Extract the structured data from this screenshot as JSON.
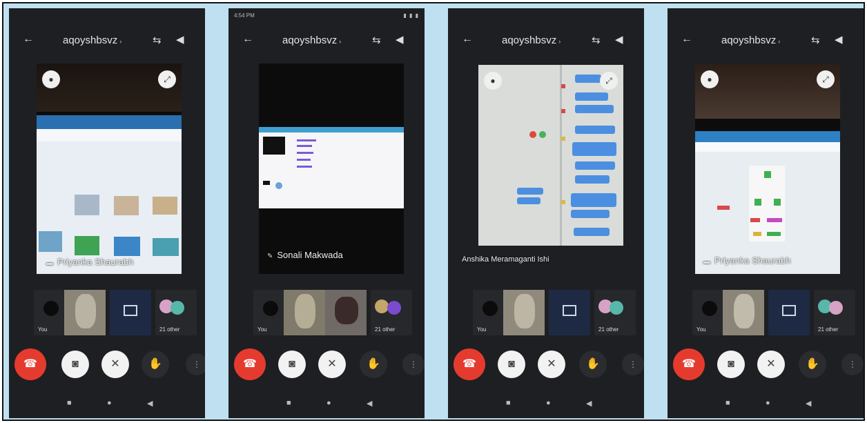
{
  "phones": [
    {
      "status_time": "",
      "title": "aqoyshbsvz",
      "caption": "Priyanka Shaurabh",
      "strip_label_1": "You",
      "strip_label_2": "",
      "strip_label_3": "",
      "strip_label_4": "21 other"
    },
    {
      "status_time": "4:54 PM",
      "title": "aqoyshbsvz",
      "caption": "Sonali Makwada",
      "strip_label_1": "You",
      "strip_label_2": "",
      "strip_label_3": "",
      "strip_label_4": "21 other"
    },
    {
      "status_time": "",
      "title": "aqoyshbsvz",
      "caption": "Anshika Meramaganti Ishi",
      "strip_label_1": "You",
      "strip_label_2": "",
      "strip_label_3": "",
      "strip_label_4": "21 other"
    },
    {
      "status_time": "",
      "title": "aqoyshbsvz",
      "caption": "Priyanka Shaurabh",
      "strip_label_1": "You",
      "strip_label_2": "",
      "strip_label_3": "",
      "strip_label_4": "21 other"
    }
  ],
  "icons": {
    "back": "arrow-left-icon",
    "switch_camera": "switch-camera-icon",
    "speaker": "speaker-icon",
    "end_call": "end-call-icon",
    "camera": "camera-icon",
    "mic": "mic-icon",
    "hand": "raise-hand-icon",
    "more": "more-icon"
  },
  "colors": {
    "end_call": "#e53b2f",
    "phone_bg": "#1e1f22",
    "frame_bg": "#bfe0f0"
  }
}
